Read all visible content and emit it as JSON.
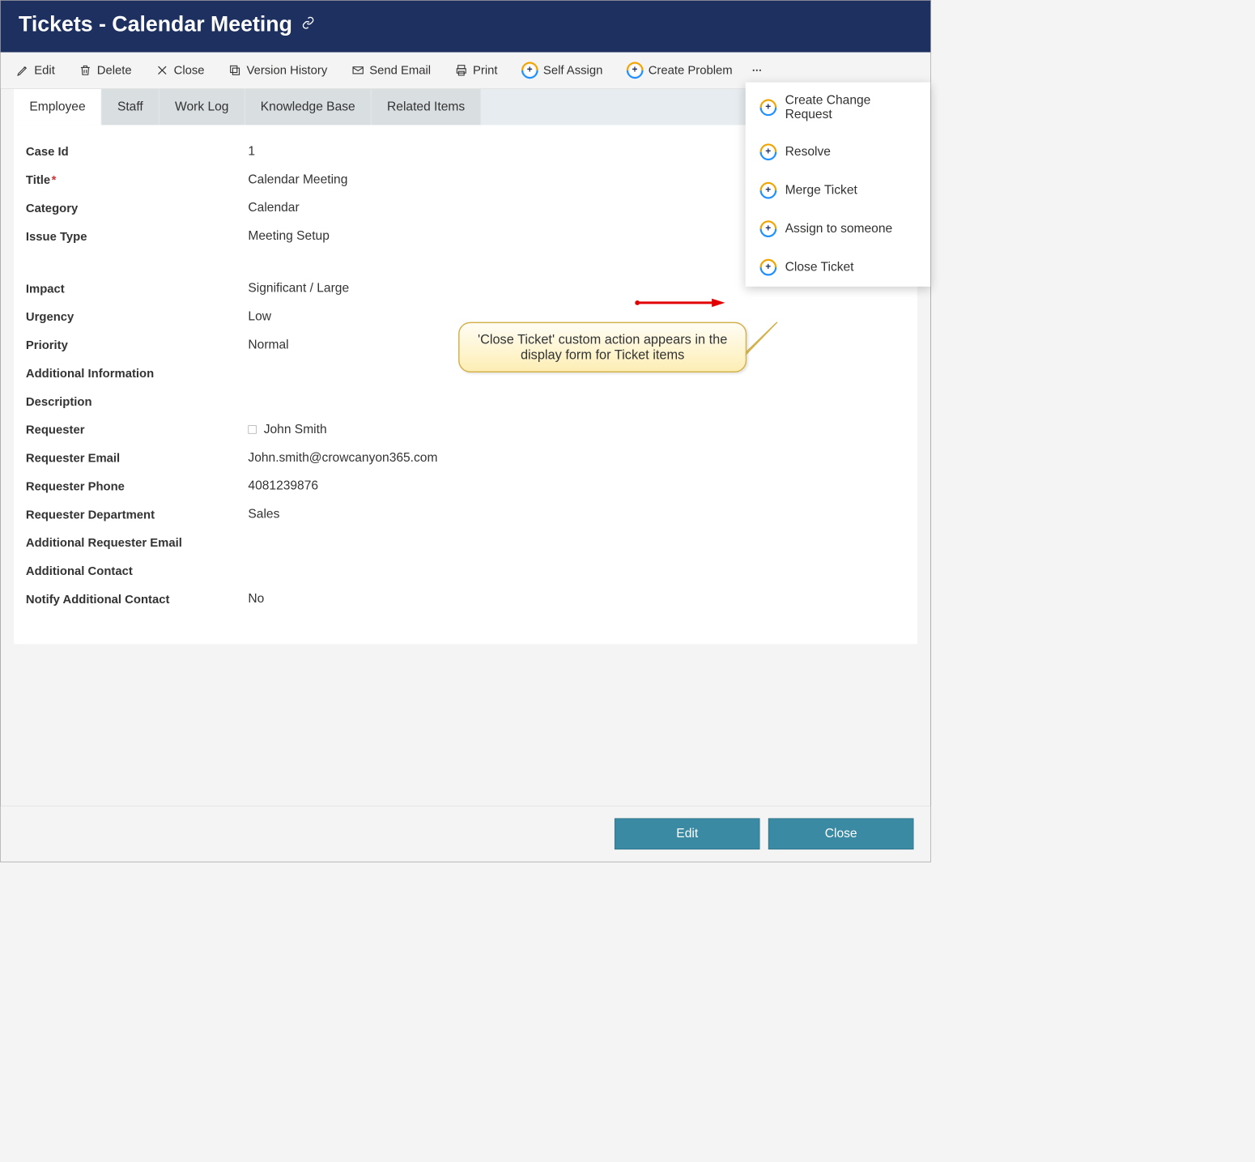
{
  "header": {
    "title": "Tickets - Calendar Meeting"
  },
  "toolbar": {
    "edit": "Edit",
    "delete": "Delete",
    "close": "Close",
    "version_history": "Version History",
    "send_email": "Send Email",
    "print": "Print",
    "self_assign": "Self Assign",
    "create_problem": "Create Problem"
  },
  "dropdown": {
    "create_change_request": "Create Change Request",
    "resolve": "Resolve",
    "merge_ticket": "Merge Ticket",
    "assign_to_someone": "Assign to someone",
    "close_ticket": "Close Ticket"
  },
  "tabs": {
    "employee": "Employee",
    "staff": "Staff",
    "work_log": "Work Log",
    "knowledge_base": "Knowledge Base",
    "related_items": "Related Items"
  },
  "fields": {
    "case_id": {
      "label": "Case Id",
      "value": "1"
    },
    "title": {
      "label": "Title",
      "value": "Calendar Meeting"
    },
    "category": {
      "label": "Category",
      "value": "Calendar"
    },
    "issue_type": {
      "label": "Issue Type",
      "value": "Meeting Setup"
    },
    "impact": {
      "label": "Impact",
      "value": "Significant / Large"
    },
    "urgency": {
      "label": "Urgency",
      "value": "Low"
    },
    "priority": {
      "label": "Priority",
      "value": "Normal"
    },
    "additional_info": {
      "label": "Additional Information",
      "value": ""
    },
    "description": {
      "label": "Description",
      "value": ""
    },
    "requester": {
      "label": "Requester",
      "value": "John Smith"
    },
    "requester_email": {
      "label": "Requester Email",
      "value": "John.smith@crowcanyon365.com"
    },
    "requester_phone": {
      "label": "Requester Phone",
      "value": "4081239876"
    },
    "requester_department": {
      "label": "Requester Department",
      "value": "Sales"
    },
    "additional_requester_email": {
      "label": "Additional Requester Email",
      "value": ""
    },
    "additional_contact": {
      "label": "Additional Contact",
      "value": ""
    },
    "notify_additional_contact": {
      "label": "Notify Additional Contact",
      "value": "No"
    }
  },
  "footer": {
    "edit": "Edit",
    "close": "Close"
  },
  "annotation": {
    "callout": "'Close Ticket' custom action appears in the display form for Ticket items"
  }
}
